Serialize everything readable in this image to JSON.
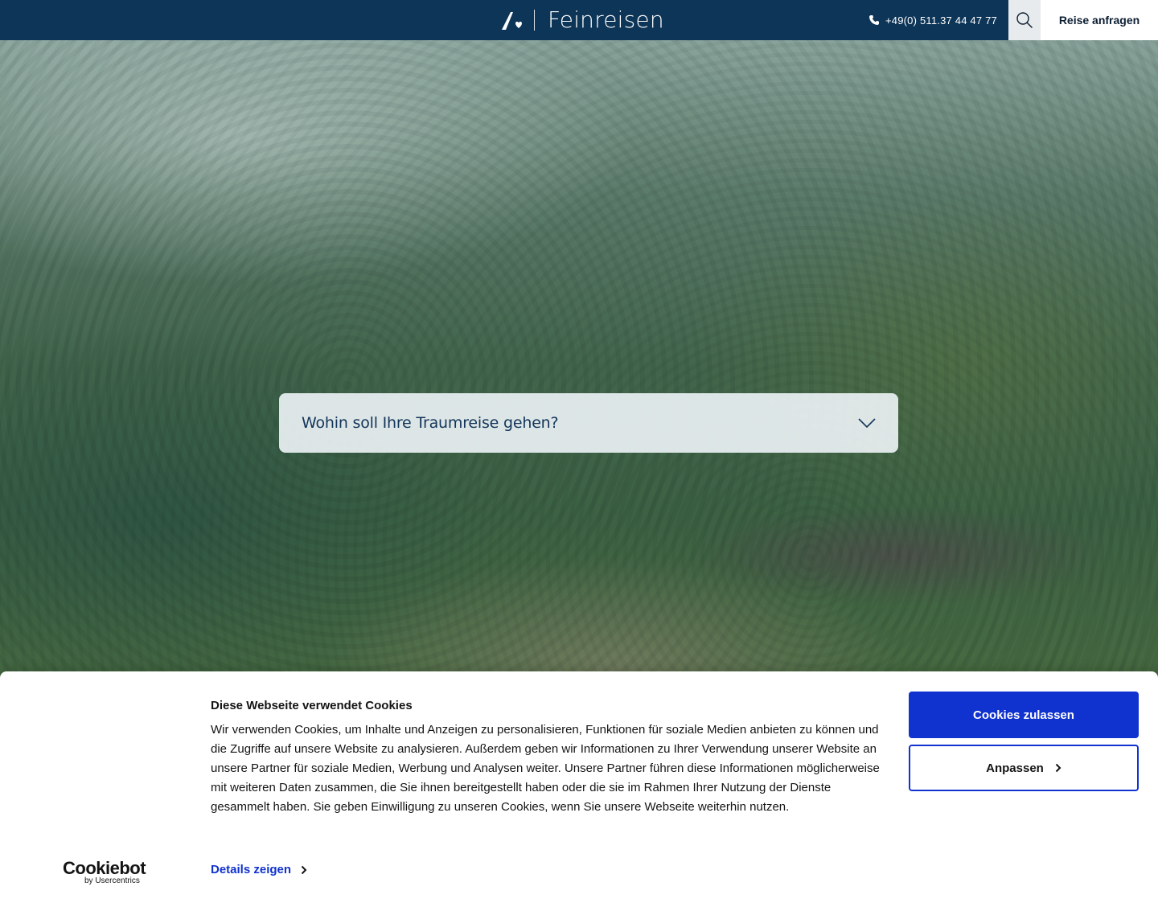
{
  "header": {
    "brand_name": "Feinreisen",
    "phone": "+49(0) 511.37 44 47 77",
    "cta_label": "Reise anfragen",
    "background": "#0d3558"
  },
  "hero": {
    "destination_placeholder": "Wohin soll Ihre Traumreise gehen?"
  },
  "cookie_banner": {
    "title": "Diese Webseite verwendet Cookies",
    "text": "Wir verwenden Cookies, um Inhalte und Anzeigen zu personalisieren, Funktionen für soziale Medien anbieten zu können und die Zugriffe auf unsere Website zu analysieren. Außerdem geben wir Informationen zu Ihrer Verwendung unserer Website an unsere Partner für soziale Medien, Werbung und Analysen weiter. Unsere Partner führen diese Informationen möglicherweise mit weiteren Daten zusammen, die Sie ihnen bereitgestellt haben oder die sie im Rahmen Ihrer Nutzung der Dienste gesammelt haben. Sie geben Einwilligung zu unseren Cookies, wenn Sie unsere Webseite weiterhin nutzen.",
    "details_label": "Details zeigen",
    "allow_label": "Cookies zulassen",
    "adjust_label": "Anpassen",
    "logo_text": "Cookiebot",
    "logo_subtext": "by Usercentrics",
    "accent": "#1032cf"
  }
}
